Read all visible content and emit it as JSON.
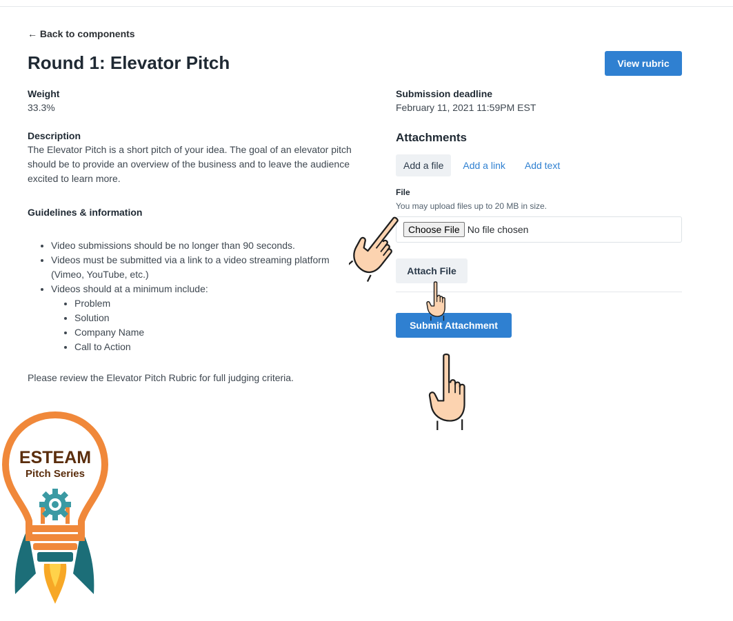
{
  "nav": {
    "back_label": "← Back to components"
  },
  "page": {
    "title": "Round 1: Elevator Pitch",
    "view_rubric_label": "View rubric"
  },
  "left": {
    "weight_label": "Weight",
    "weight_value": "33.3%",
    "description_label": "Description",
    "description_text": "The Elevator Pitch is a short pitch of your idea. The goal of an elevator pitch should be to provide an overview of the business and to leave the audience excited to learn more.",
    "guidelines_label": "Guidelines & information",
    "guidelines": [
      "Video submissions should be no longer than 90 seconds.",
      "Videos must be submitted via a link to a video streaming platform (Vimeo, YouTube, etc.)",
      "Videos should at a minimum include:"
    ],
    "sub_guidelines": [
      "Problem",
      "Solution",
      "Company Name",
      "Call to Action"
    ],
    "review_text": "Please review the Elevator Pitch Rubric for full judging criteria."
  },
  "right": {
    "deadline_label": "Submission deadline",
    "deadline_value": "February 11, 2021 11:59PM EST",
    "attachments_heading": "Attachments",
    "tabs": [
      {
        "label": "Add a file",
        "active": true
      },
      {
        "label": "Add a link",
        "active": false
      },
      {
        "label": "Add text",
        "active": false
      }
    ],
    "file_label": "File",
    "file_hint": "You may upload files up to 20 MB in size.",
    "choose_file_label": "Choose File",
    "no_file_text": "No file chosen",
    "attach_file_label": "Attach File",
    "submit_label": "Submit Attachment"
  },
  "logo": {
    "line1": "ESTEAM",
    "line2": "Pitch Series"
  },
  "colors": {
    "primary": "#2f80d1",
    "logo_orange": "#f0883a",
    "logo_teal": "#1c6e78",
    "logo_brown": "#5a2d0c",
    "hand_skin": "#fcd3b0"
  },
  "icons": [
    "pointing-hand-icon",
    "gear-icon",
    "lightbulb-rocket-logo"
  ]
}
